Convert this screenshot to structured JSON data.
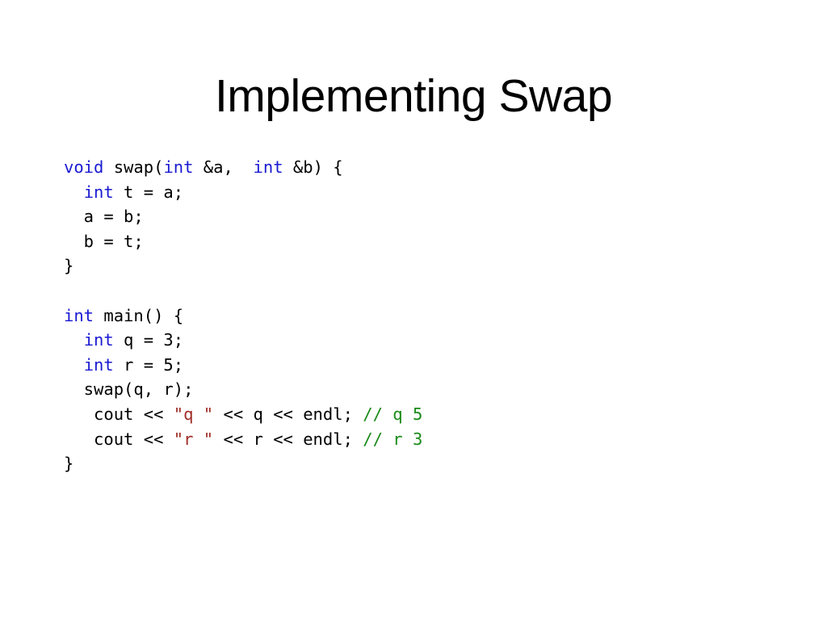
{
  "slide": {
    "title": "Implementing Swap",
    "background_color": "#ffffff",
    "title_color": "#000000"
  },
  "colors": {
    "keyword": "#1a1ad2",
    "string": "#9e2b25",
    "comment": "#188a18",
    "plain": "#000000"
  },
  "code": {
    "language": "cpp",
    "full_text": "void swap(int &a,  int &b) {\n  int t = a;\n  a = b;\n  b = t;\n}\n\nint main() {\n  int q = 3;\n  int r = 5;\n  swap(q, r);\n   cout << \"q \" << q << endl; // q 5\n   cout << \"r \" << r << endl; // r 3\n}",
    "lines": [
      {
        "index": 0,
        "text": "void swap(int &a,  int &b) {",
        "tokens": [
          {
            "t": "void",
            "c": "keyword"
          },
          {
            "t": " swap(",
            "c": "plain"
          },
          {
            "t": "int",
            "c": "keyword"
          },
          {
            "t": " &a,  ",
            "c": "plain"
          },
          {
            "t": "int",
            "c": "keyword"
          },
          {
            "t": " &b) {",
            "c": "plain"
          }
        ]
      },
      {
        "index": 1,
        "text": "  int t = a;",
        "tokens": [
          {
            "t": "  ",
            "c": "plain"
          },
          {
            "t": "int",
            "c": "keyword"
          },
          {
            "t": " t = a;",
            "c": "plain"
          }
        ]
      },
      {
        "index": 2,
        "text": "  a = b;",
        "tokens": [
          {
            "t": "  a = b;",
            "c": "plain"
          }
        ]
      },
      {
        "index": 3,
        "text": "  b = t;",
        "tokens": [
          {
            "t": "  b = t;",
            "c": "plain"
          }
        ]
      },
      {
        "index": 4,
        "text": "}",
        "tokens": [
          {
            "t": "}",
            "c": "plain"
          }
        ]
      },
      {
        "index": 5,
        "text": "",
        "tokens": []
      },
      {
        "index": 6,
        "text": "int main() {",
        "tokens": [
          {
            "t": "int",
            "c": "keyword"
          },
          {
            "t": " main() {",
            "c": "plain"
          }
        ]
      },
      {
        "index": 7,
        "text": "  int q = 3;",
        "tokens": [
          {
            "t": "  ",
            "c": "plain"
          },
          {
            "t": "int",
            "c": "keyword"
          },
          {
            "t": " q = 3;",
            "c": "plain"
          }
        ]
      },
      {
        "index": 8,
        "text": "  int r = 5;",
        "tokens": [
          {
            "t": "  ",
            "c": "plain"
          },
          {
            "t": "int",
            "c": "keyword"
          },
          {
            "t": " r = 5;",
            "c": "plain"
          }
        ]
      },
      {
        "index": 9,
        "text": "  swap(q, r);",
        "tokens": [
          {
            "t": "  swap(q, r);",
            "c": "plain"
          }
        ]
      },
      {
        "index": 10,
        "text": "   cout << \"q \" << q << endl; // q 5",
        "tokens": [
          {
            "t": "   cout << ",
            "c": "plain"
          },
          {
            "t": "\"q \"",
            "c": "string"
          },
          {
            "t": " << q << endl; ",
            "c": "plain"
          },
          {
            "t": "// q 5",
            "c": "comment"
          }
        ]
      },
      {
        "index": 11,
        "text": "   cout << \"r \" << r << endl; // r 3",
        "tokens": [
          {
            "t": "   cout << ",
            "c": "plain"
          },
          {
            "t": "\"r \"",
            "c": "string"
          },
          {
            "t": " << r << endl; ",
            "c": "plain"
          },
          {
            "t": "// r 3",
            "c": "comment"
          }
        ]
      },
      {
        "index": 12,
        "text": "}",
        "tokens": [
          {
            "t": "}",
            "c": "plain"
          }
        ]
      }
    ]
  }
}
